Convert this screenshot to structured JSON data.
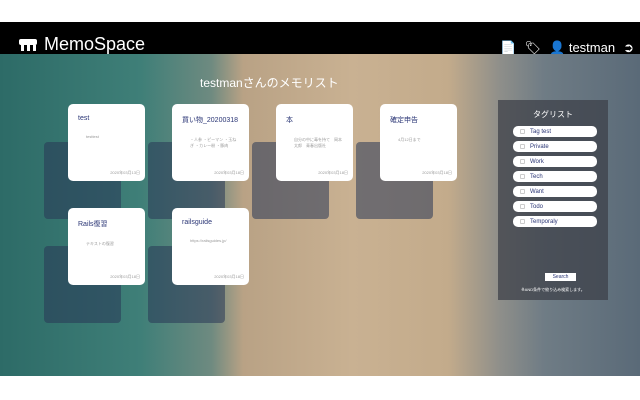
{
  "nav": {
    "brand": "MemoSpace",
    "user": "testman"
  },
  "title": "testmanさんのメモリスト",
  "memos": [
    {
      "title": "test",
      "body": "testtest",
      "date": "2020年03月13日"
    },
    {
      "title": "買い物_20200318",
      "body": "・人参 ・ピーマン ・玉ねぎ ・カレー粉 ・豚肉",
      "date": "2020年03月18日"
    },
    {
      "title": "本",
      "body": "自分の中に毒を持て　岡本太郎　青春出版社",
      "date": "2020年03月18日"
    },
    {
      "title": "確定申告",
      "body": "4月12日まで",
      "date": "2020年03月18日"
    },
    {
      "title": "Rails復習",
      "body": "テキストの復習",
      "date": "2020年03月18日"
    },
    {
      "title": "railsguide",
      "body": "https://railsguides.jp/",
      "date": "2020年03月18日"
    }
  ],
  "tags": {
    "title": "タグリスト",
    "items": [
      "Tag test",
      "Private",
      "Work",
      "Tech",
      "Want",
      "Todo",
      "Temporaly"
    ],
    "search_label": "Search",
    "note": "※AND条件で絞り込み検索します。"
  }
}
